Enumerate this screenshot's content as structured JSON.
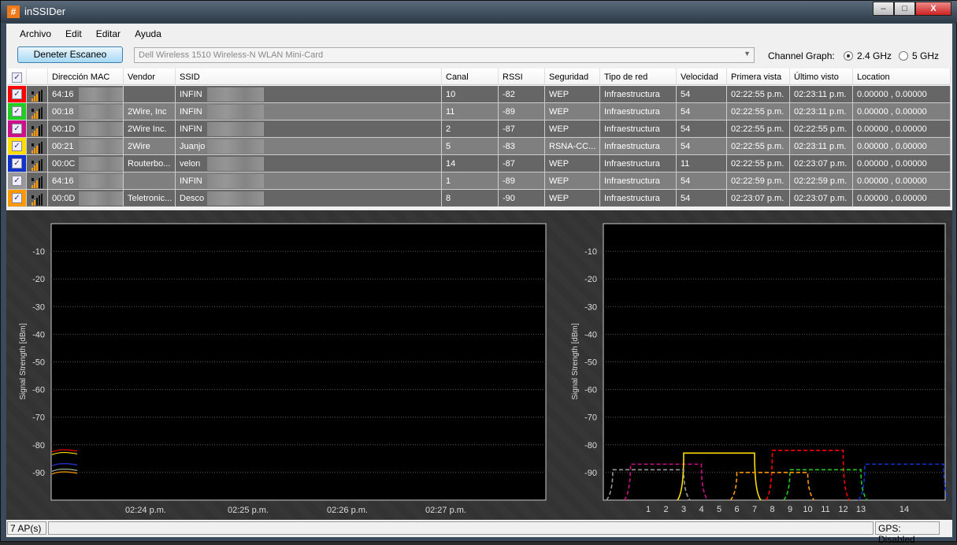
{
  "window": {
    "title": "inSSIDer",
    "minimize": "–",
    "maximize": "□",
    "close": "X"
  },
  "menu": [
    "Archivo",
    "Edit",
    "Editar",
    "Ayuda"
  ],
  "toolbar": {
    "scan_button": "Deneter Escaneo",
    "adapter": "Dell Wireless 1510 Wireless-N WLAN Mini-Card",
    "channel_graph_label": "Channel Graph:",
    "band_24": "2.4 GHz",
    "band_5": "5 GHz",
    "selected_band": "2.4 GHz"
  },
  "table": {
    "columns": [
      "",
      "",
      "Dirección MAC",
      "Vendor",
      "SSID",
      "Canal",
      "RSSI",
      "Seguridad",
      "Tipo de red",
      "Velocidad",
      "Primera vista",
      "Último visto",
      "Location"
    ],
    "rows": [
      {
        "color": "#ff0000",
        "mac": "64:16",
        "vendor": "",
        "ssid": "INFIN",
        "canal": "10",
        "rssi": "-82",
        "seg": "WEP",
        "tipo": "Infraestructura",
        "vel": "54",
        "primera": "02:22:55 p.m.",
        "ultimo": "02:23:11 p.m.",
        "loc": "0.00000 , 0.00000"
      },
      {
        "color": "#22cc22",
        "mac": "00:18",
        "vendor": "2Wire, Inc",
        "ssid": "INFIN",
        "canal": "11",
        "rssi": "-89",
        "seg": "WEP",
        "tipo": "Infraestructura",
        "vel": "54",
        "primera": "02:22:55 p.m.",
        "ultimo": "02:23:11 p.m.",
        "loc": "0.00000 , 0.00000"
      },
      {
        "color": "#cc1188",
        "mac": "00:1D",
        "vendor": "2Wire Inc.",
        "ssid": "INFIN",
        "canal": "2",
        "rssi": "-87",
        "seg": "WEP",
        "tipo": "Infraestructura",
        "vel": "54",
        "primera": "02:22:55 p.m.",
        "ultimo": "02:22:55 p.m.",
        "loc": "0.00000 , 0.00000"
      },
      {
        "color": "#ffdd00",
        "mac": "00:21",
        "vendor": "2Wire",
        "ssid": "Juanjo",
        "canal": "5",
        "rssi": "-83",
        "seg": "RSNA-CC...",
        "tipo": "Infraestructura",
        "vel": "54",
        "primera": "02:22:55 p.m.",
        "ultimo": "02:23:11 p.m.",
        "loc": "0.00000 , 0.00000"
      },
      {
        "color": "#1133cc",
        "mac": "00:0C",
        "vendor": "Routerbo...",
        "ssid": "velon",
        "canal": "14",
        "rssi": "-87",
        "seg": "WEP",
        "tipo": "Infraestructura",
        "vel": "11",
        "primera": "02:22:55 p.m.",
        "ultimo": "02:23:07 p.m.",
        "loc": "0.00000 , 0.00000"
      },
      {
        "color": "#999999",
        "mac": "64:16",
        "vendor": "",
        "ssid": "INFIN",
        "canal": "1",
        "rssi": "-89",
        "seg": "WEP",
        "tipo": "Infraestructura",
        "vel": "54",
        "primera": "02:22:59 p.m.",
        "ultimo": "02:22:59 p.m.",
        "loc": "0.00000 , 0.00000"
      },
      {
        "color": "#ff9900",
        "mac": "00:0D",
        "vendor": "Teletronic...",
        "ssid": "Desco",
        "canal": "8",
        "rssi": "-90",
        "seg": "WEP",
        "tipo": "Infraestructura",
        "vel": "54",
        "primera": "02:23:07 p.m.",
        "ultimo": "02:23:07 p.m.",
        "loc": "0.00000 , 0.00000"
      }
    ]
  },
  "chart_data": [
    {
      "type": "line",
      "ylabel": "Signal Strength [dBm]",
      "ylim": [
        -100,
        0
      ],
      "yticks": [
        "-10",
        "-20",
        "-30",
        "-40",
        "-50",
        "-60",
        "-70",
        "-80",
        "-90"
      ],
      "xticks": [
        "02:24 p.m.",
        "02:25 p.m.",
        "02:26 p.m.",
        "02:27 p.m."
      ],
      "grid": true
    },
    {
      "type": "area",
      "ylabel": "Signal Strength [dBm]",
      "ylim": [
        -100,
        0
      ],
      "yticks": [
        "-10",
        "-20",
        "-30",
        "-40",
        "-50",
        "-60",
        "-70",
        "-80",
        "-90"
      ],
      "xticks": [
        "1",
        "2",
        "3",
        "4",
        "5",
        "6",
        "7",
        "8",
        "9",
        "10",
        "11",
        "12",
        "13",
        "14"
      ],
      "grid": true
    }
  ],
  "status": {
    "ap_count": "7 AP(s)",
    "gps": "GPS: Disabled"
  }
}
